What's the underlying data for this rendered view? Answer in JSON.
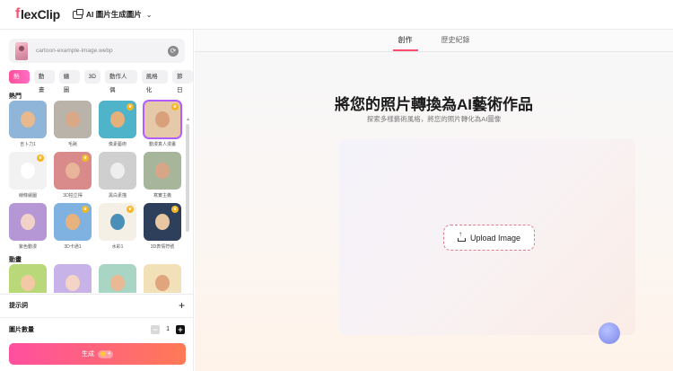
{
  "topbar": {
    "logo_f": "f",
    "logo_rest": "lexClip",
    "tool_name": "AI 圖片生成圖片"
  },
  "sidebar": {
    "file_name": "cartoon-example-image.webp",
    "categories": [
      {
        "label": "熱門",
        "active": true
      },
      {
        "label": "動畫",
        "active": false
      },
      {
        "label": "繪圖",
        "active": false
      },
      {
        "label": "3D",
        "active": false
      },
      {
        "label": "動作人偶",
        "active": false
      },
      {
        "label": "風格化",
        "active": false
      },
      {
        "label": "節日",
        "active": false
      }
    ],
    "section_popular": "熱門",
    "popular_styles": [
      {
        "label": "吉卜力1",
        "premium": false,
        "selected": false,
        "bg": "#8fb6d8",
        "face": "#e8b98f"
      },
      {
        "label": "毛氈",
        "premium": false,
        "selected": false,
        "bg": "#b9b3aa",
        "face": "#d9a888"
      },
      {
        "label": "像素藝術",
        "premium": true,
        "selected": false,
        "bg": "#4fb3c9",
        "face": "#e6b07a"
      },
      {
        "label": "動漫真人漫畫",
        "premium": true,
        "selected": true,
        "bg": "#e6c9a8",
        "face": "#d9a07c"
      },
      {
        "label": "線條繪圖",
        "premium": true,
        "selected": false,
        "bg": "#f2f2f2",
        "face": "#ffffff"
      },
      {
        "label": "3D拍立得",
        "premium": true,
        "selected": false,
        "bg": "#d98a8a",
        "face": "#e8b49a"
      },
      {
        "label": "黑白素描",
        "premium": false,
        "selected": false,
        "bg": "#cfcfcf",
        "face": "#eeeeee"
      },
      {
        "label": "寫實主義",
        "premium": false,
        "selected": false,
        "bg": "#a7b59a",
        "face": "#d6a687"
      },
      {
        "label": "紫色動漫",
        "premium": false,
        "selected": false,
        "bg": "#b697d6",
        "face": "#f2d2c8"
      },
      {
        "label": "3D卡通1",
        "premium": true,
        "selected": false,
        "bg": "#7fb2e0",
        "face": "#e8b27f"
      },
      {
        "label": "水彩1",
        "premium": true,
        "selected": false,
        "bg": "#f5f0e6",
        "face": "#4a8fb8"
      },
      {
        "label": "3D表情符號",
        "premium": true,
        "selected": false,
        "bg": "#2e3f5c",
        "face": "#e8c7a2"
      }
    ],
    "section_anime": "動畫",
    "anime_styles": [
      {
        "bg": "#b8d87a",
        "face": "#f2c9a4"
      },
      {
        "bg": "#c7b3e8",
        "face": "#f4d4c4"
      },
      {
        "bg": "#a9d6c4",
        "face": "#e9b994"
      },
      {
        "bg": "#f2e0b8",
        "face": "#e0a57d"
      }
    ],
    "prompt_label": "提示詞",
    "count_label": "圖片數量",
    "count_value": "1",
    "generate_label": "生成",
    "generate_cost": "4"
  },
  "main": {
    "tabs": [
      {
        "label": "創作",
        "active": true
      },
      {
        "label": "歷史紀錄",
        "active": false
      }
    ],
    "headline": "將您的照片轉換為AI藝術作品",
    "subline": "探索多樣藝術風格，將您的照片轉化為AI圖像",
    "upload_label": "Upload Image"
  },
  "colors": {
    "accent": "#ff4d6d",
    "generate_start": "#ff4fa0",
    "generate_end": "#ff7a55",
    "upload_border": "#e07a8c"
  }
}
